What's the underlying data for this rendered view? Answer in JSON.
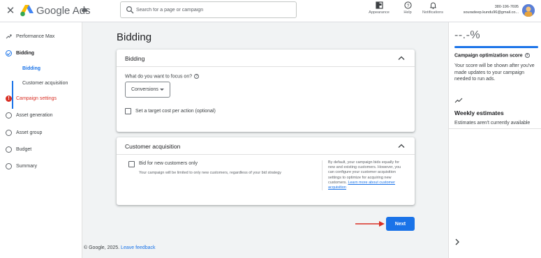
{
  "topbar": {
    "product_name": "Google Ads",
    "search_placeholder": "Search for a page or campaign",
    "appearance_label": "Appearance",
    "help_label": "Help",
    "notifications_label": "Notifications",
    "account_id": "380-196-7695",
    "account_email": "souradeep.kundu96@gmail.co..."
  },
  "sidebar": {
    "items": [
      {
        "label": "Performance Max",
        "icon": "performance-max-icon",
        "state": "default"
      },
      {
        "label": "Bidding",
        "icon": "check-circle-icon",
        "state": "active"
      },
      {
        "label": "Campaign settings",
        "icon": "error-icon",
        "state": "error"
      },
      {
        "label": "Asset generation",
        "icon": "circle-icon",
        "state": "default"
      },
      {
        "label": "Asset group",
        "icon": "circle-icon",
        "state": "default"
      },
      {
        "label": "Budget",
        "icon": "circle-icon",
        "state": "default"
      },
      {
        "label": "Summary",
        "icon": "circle-icon",
        "state": "default"
      }
    ],
    "subitems": [
      {
        "label": "Bidding",
        "state": "active"
      },
      {
        "label": "Customer acquisition",
        "state": "default"
      }
    ]
  },
  "main": {
    "page_title": "Bidding",
    "bidding_card": {
      "title": "Bidding",
      "question": "What do you want to focus on?",
      "focus_value": "Conversions",
      "target_cpa_label": "Set a target cost per action (optional)",
      "target_cpa_checked": false
    },
    "acquisition_card": {
      "title": "Customer acquisition",
      "checkbox_label": "Bid for new customers only",
      "checkbox_checked": false,
      "helper": "Your campaign will be limited to only new customers, regardless of your bid strategy",
      "side_note": "By default, your campaign bids equally for new and existing customers. However, you can configure your customer acquisition settings to optimize for acquiring new customers.",
      "learn_more": "Learn more about customer acquisition"
    },
    "next_label": "Next"
  },
  "footer": {
    "copyright": "© Google, 2025.",
    "feedback": "Leave feedback"
  },
  "right_panel": {
    "score_value": "--.-%",
    "score_fill": 1.0,
    "score_title": "Campaign optimization score",
    "score_text": "Your score will be shown after you've made updates to your campaign needed to run ads.",
    "weekly_title": "Weekly estimates",
    "weekly_text": "Estimates aren't currently available"
  },
  "colors": {
    "accent": "#1a73e8",
    "error": "#d93025",
    "arrow": "#d93025"
  }
}
